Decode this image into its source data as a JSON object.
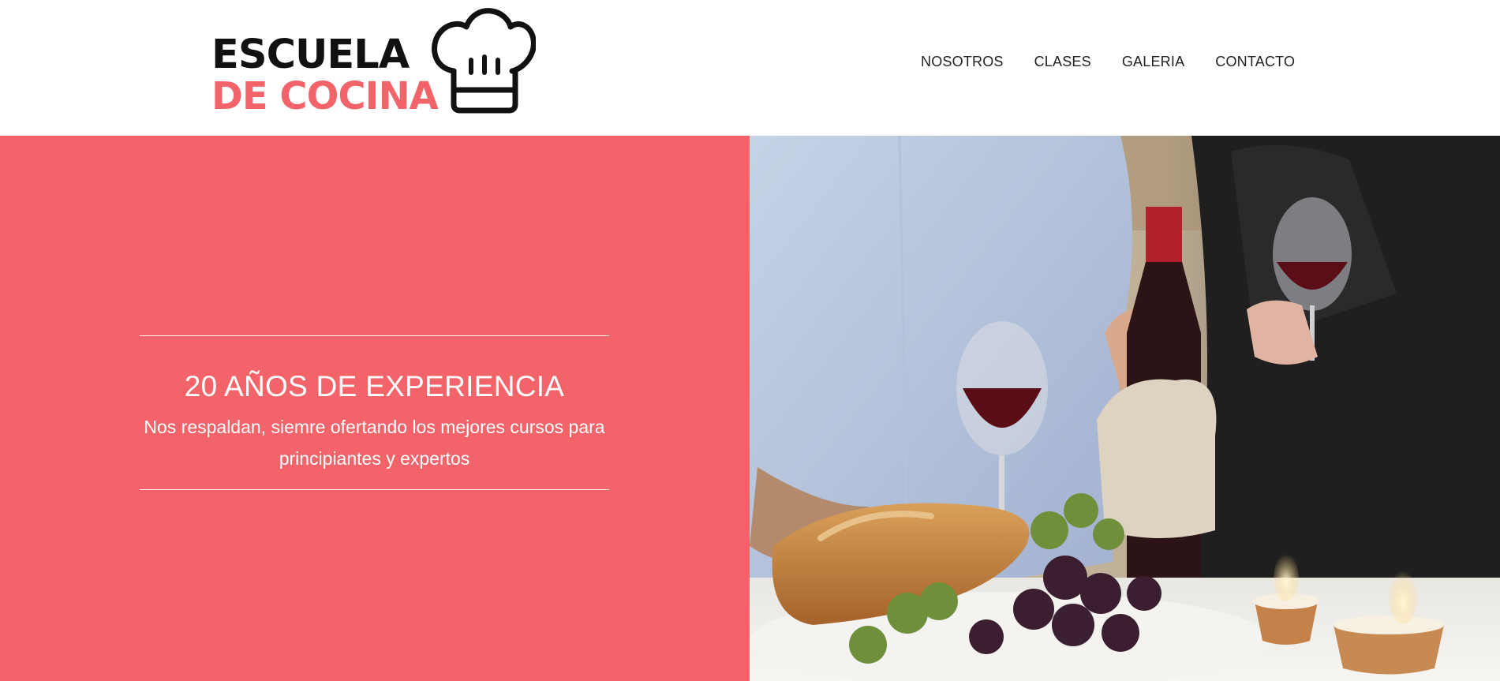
{
  "logo": {
    "line1": "ESCUELA",
    "line2": "DE COCINA",
    "icon": "chef-hat-icon",
    "colors": {
      "dark": "#111111",
      "accent": "#f26469"
    }
  },
  "nav": {
    "items": [
      {
        "label": "NOSOTROS"
      },
      {
        "label": "CLASES"
      },
      {
        "label": "GALERIA"
      },
      {
        "label": "CONTACTO"
      }
    ]
  },
  "hero": {
    "title": "20 AÑOS DE EXPERIENCIA",
    "text": "Nos respaldan, siemre ofertando los mejores cursos para principiantes y expertos",
    "background_color": "#f26469",
    "photo": "wine-bread-grapes-photo"
  }
}
